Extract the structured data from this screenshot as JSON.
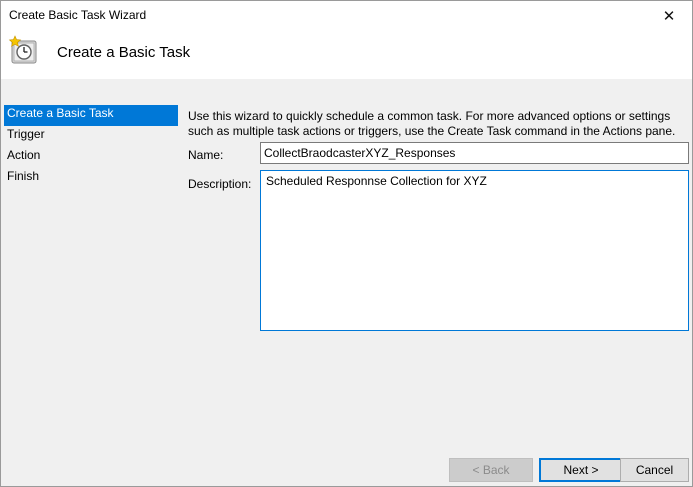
{
  "window": {
    "title": "Create Basic Task Wizard",
    "close_glyph": "✕"
  },
  "header": {
    "title": "Create a Basic Task",
    "icon": "scheduled-task-clock-icon"
  },
  "steps": [
    {
      "label": "Create a Basic Task",
      "active": true
    },
    {
      "label": "Trigger",
      "active": false
    },
    {
      "label": "Action",
      "active": false
    },
    {
      "label": "Finish",
      "active": false
    }
  ],
  "form": {
    "intro": "Use this wizard to quickly schedule a common task.  For more advanced options or settings such as multiple task actions or triggers, use the Create Task command in the Actions pane.",
    "name_label": "Name:",
    "name_value": "CollectBraodcasterXYZ_Responses",
    "description_label": "Description:",
    "description_value": "Scheduled Responnse Collection for XYZ"
  },
  "buttons": {
    "back": "< Back",
    "next": "Next >",
    "cancel": "Cancel"
  },
  "colors": {
    "accent": "#0078d7",
    "panel": "#f0f0f0"
  }
}
